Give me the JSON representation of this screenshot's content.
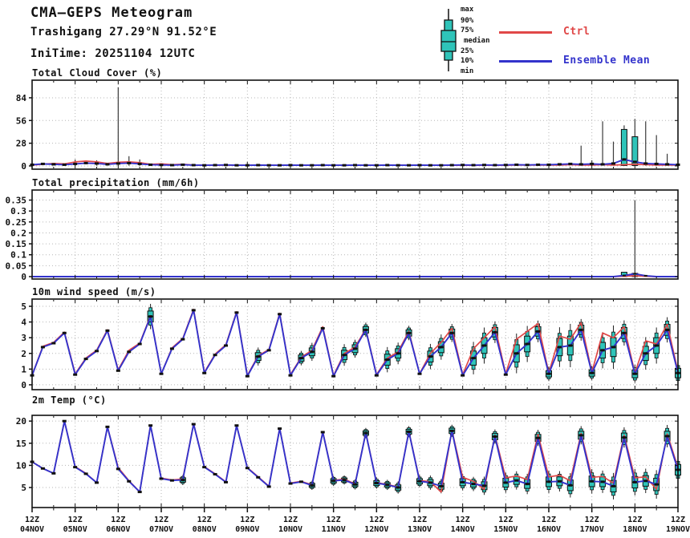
{
  "header": {
    "title": "CMA—GEPS Meteogram",
    "location": "Trashigang 27.29°N 91.52°E",
    "initime": "IniTime: 20251104 12UTC"
  },
  "legend": {
    "box_labels": [
      "max",
      "90%",
      "75%",
      "median",
      "25%",
      "10%",
      "min"
    ],
    "ctrl_label": "Ctrl",
    "mean_label": "Ensemble Mean",
    "ctrl_color": "#e04848",
    "mean_color": "#3333cc",
    "box_fill": "#2fc4b9"
  },
  "axis": {
    "z_label": "12Z",
    "day_labels": [
      "04NOV",
      "05NOV",
      "06NOV",
      "07NOV",
      "08NOV",
      "09NOV",
      "10NOV",
      "11NOV",
      "12NOV",
      "13NOV",
      "14NOV",
      "15NOV",
      "16NOV",
      "17NOV",
      "18NOV",
      "19NOV"
    ]
  },
  "chart_data": [
    {
      "type": "line",
      "title": "Total Cloud Cover (%)",
      "x_start": "04NOV 12Z",
      "x_step_hours": 6,
      "yticks": [
        0,
        28,
        56,
        84
      ],
      "ylim": [
        -4,
        105.7
      ],
      "markers": "all",
      "series": [
        {
          "name": "Ctrl",
          "color": "#e04848",
          "values": [
            1.0,
            2.0,
            3.0,
            2.5,
            5.0,
            6.0,
            5.0,
            3.0,
            4.5,
            5.0,
            4.0,
            2.0,
            2.5,
            1.5,
            2.0,
            1.0,
            1.0,
            0.8,
            1.0,
            0.8,
            0.8,
            0.8,
            0.8,
            0.8,
            0.8,
            0.8,
            0.8,
            0.8,
            0.8,
            0.8,
            0.8,
            0.8,
            0.8,
            0.8,
            0.8,
            0.8,
            0.8,
            0.8,
            0.8,
            0.8,
            0.8,
            0.8,
            0.8,
            0.8,
            0.8,
            1.0,
            1.0,
            1.0,
            1.0,
            1.0,
            1.5,
            1.0,
            1.0,
            1.5,
            1.0,
            1.5,
            2.0,
            1.5,
            1.0,
            1.0,
            1.0
          ]
        },
        {
          "name": "Ensemble Mean",
          "color": "#3333cc",
          "values": [
            1.5,
            2.5,
            2.0,
            1.5,
            2.5,
            3.5,
            3.0,
            2.0,
            3.0,
            3.5,
            2.5,
            1.5,
            1.2,
            1.0,
            1.5,
            1.0,
            0.8,
            1.0,
            1.2,
            0.8,
            0.8,
            1.0,
            0.8,
            0.8,
            1.0,
            0.8,
            0.8,
            1.0,
            0.8,
            0.8,
            1.0,
            0.8,
            0.8,
            1.0,
            0.8,
            0.8,
            1.0,
            0.8,
            0.8,
            1.0,
            1.2,
            1.0,
            1.2,
            1.0,
            1.2,
            1.5,
            1.2,
            1.5,
            1.5,
            2.0,
            2.5,
            2.0,
            2.5,
            2.0,
            3.0,
            8.0,
            5.0,
            3.0,
            2.5,
            2.0,
            1.5
          ]
        }
      ],
      "whiskers": [
        {
          "i": 4,
          "lo": 0.3,
          "hi": 8
        },
        {
          "i": 6,
          "lo": 0.3,
          "hi": 7
        },
        {
          "i": 8,
          "lo": 0.3,
          "hi": 97
        },
        {
          "i": 9,
          "lo": 0.3,
          "hi": 12
        },
        {
          "i": 10,
          "lo": 0.3,
          "hi": 8
        },
        {
          "i": 20,
          "lo": 0.3,
          "hi": 5
        },
        {
          "i": 51,
          "lo": 0.3,
          "hi": 25
        },
        {
          "i": 52,
          "lo": 0.3,
          "hi": 7
        },
        {
          "i": 53,
          "lo": 0.3,
          "hi": 55
        },
        {
          "i": 54,
          "lo": 0.3,
          "hi": 30
        },
        {
          "i": 55,
          "lo": 0.3,
          "hi": 50
        },
        {
          "i": 56,
          "lo": 0.3,
          "hi": 58
        },
        {
          "i": 57,
          "lo": 0.3,
          "hi": 55
        },
        {
          "i": 58,
          "lo": 0.3,
          "hi": 38
        },
        {
          "i": 59,
          "lo": 0.3,
          "hi": 15
        }
      ],
      "boxes": [
        {
          "i": 55,
          "q1": 0.5,
          "q3": 45
        },
        {
          "i": 56,
          "q1": 0.5,
          "q3": 36
        }
      ]
    },
    {
      "type": "line",
      "title": "Total precipitation (mm/6h)",
      "x_start": "04NOV 12Z",
      "x_step_hours": 6,
      "yticks": [
        0,
        0.05,
        0.1,
        0.15,
        0.2,
        0.25,
        0.3,
        0.35
      ],
      "ylim": [
        -0.011,
        0.396
      ],
      "markers": "sparse",
      "series": [
        {
          "name": "Ctrl",
          "color": "#e04848",
          "values": [
            0,
            0,
            0,
            0,
            0,
            0,
            0,
            0,
            0,
            0,
            0,
            0,
            0,
            0,
            0,
            0,
            0,
            0,
            0,
            0,
            0,
            0,
            0,
            0,
            0,
            0,
            0,
            0,
            0,
            0,
            0,
            0,
            0,
            0,
            0,
            0,
            0,
            0,
            0,
            0,
            0,
            0,
            0,
            0,
            0,
            0,
            0,
            0,
            0,
            0,
            0,
            0,
            0,
            0,
            0,
            0.002,
            0.004,
            0.001,
            0,
            0,
            0
          ]
        },
        {
          "name": "Ensemble Mean",
          "color": "#3333cc",
          "values": [
            0,
            0,
            0,
            0,
            0,
            0,
            0,
            0,
            0,
            0,
            0,
            0,
            0,
            0,
            0,
            0,
            0,
            0,
            0,
            0,
            0,
            0,
            0,
            0,
            0,
            0,
            0,
            0,
            0,
            0,
            0,
            0,
            0,
            0,
            0,
            0,
            0,
            0,
            0,
            0,
            0,
            0,
            0,
            0,
            0,
            0,
            0,
            0,
            0,
            0,
            0,
            0,
            0,
            0,
            0,
            0.005,
            0.013,
            0.004,
            0,
            0,
            0
          ]
        }
      ],
      "whiskers": [
        {
          "i": 56,
          "lo": 0,
          "hi": 0.35
        }
      ],
      "boxes": [
        {
          "i": 55,
          "q1": 0,
          "q3": 0.02
        },
        {
          "i": 56,
          "q1": 0,
          "q3": 0.015
        }
      ]
    },
    {
      "type": "line",
      "title": "10m wind speed (m/s)",
      "x_start": "04NOV 12Z",
      "x_step_hours": 6,
      "yticks": [
        0,
        1,
        2,
        3,
        4,
        5
      ],
      "ylim": [
        -0.31,
        5.46
      ],
      "markers": "all",
      "box_threshold": 0.2,
      "series": [
        {
          "name": "Ctrl",
          "color": "#e04848",
          "values": [
            0.6,
            2.45,
            2.7,
            3.35,
            0.7,
            1.7,
            2.2,
            3.5,
            0.95,
            2.2,
            2.65,
            4.4,
            0.7,
            2.35,
            2.95,
            4.8,
            0.8,
            1.95,
            2.55,
            4.65,
            0.6,
            1.85,
            2.25,
            4.55,
            0.65,
            1.75,
            2.2,
            3.7,
            0.6,
            2.0,
            2.4,
            3.55,
            0.65,
            1.7,
            2.1,
            3.4,
            0.7,
            2.0,
            2.7,
            3.6,
            0.65,
            2.3,
            3.0,
            3.7,
            0.7,
            2.9,
            3.4,
            3.9,
            0.75,
            3.1,
            2.9,
            3.95,
            0.8,
            3.3,
            3.0,
            3.7,
            0.75,
            2.8,
            2.6,
            3.85,
            0.85
          ]
        },
        {
          "name": "Ensemble Mean",
          "color": "#3333cc",
          "values": [
            0.6,
            2.4,
            2.65,
            3.3,
            0.65,
            1.65,
            2.15,
            3.45,
            0.9,
            2.1,
            2.6,
            4.35,
            0.7,
            2.3,
            2.9,
            4.75,
            0.75,
            1.9,
            2.5,
            4.6,
            0.55,
            1.8,
            2.2,
            4.5,
            0.6,
            1.7,
            2.1,
            3.6,
            0.55,
            1.9,
            2.3,
            3.5,
            0.6,
            1.6,
            2.0,
            3.3,
            0.7,
            1.8,
            2.4,
            3.3,
            0.6,
            1.7,
            2.5,
            3.35,
            0.65,
            2.0,
            2.6,
            3.4,
            0.7,
            2.4,
            2.5,
            3.5,
            0.75,
            2.2,
            2.4,
            3.3,
            0.7,
            2.0,
            2.5,
            3.5,
            0.75
          ]
        }
      ],
      "spread": [
        0.05,
        0.05,
        0.05,
        0.1,
        0.06,
        0.12,
        0.1,
        0.12,
        0.1,
        0.1,
        0.08,
        0.35,
        0.07,
        0.15,
        0.12,
        0.1,
        0.1,
        0.15,
        0.12,
        0.12,
        0.08,
        0.25,
        0.15,
        0.15,
        0.1,
        0.2,
        0.25,
        0.15,
        0.1,
        0.3,
        0.25,
        0.2,
        0.12,
        0.35,
        0.3,
        0.2,
        0.12,
        0.35,
        0.35,
        0.25,
        0.15,
        0.45,
        0.5,
        0.3,
        0.15,
        0.55,
        0.5,
        0.3,
        0.2,
        0.55,
        0.6,
        0.3,
        0.2,
        0.5,
        0.6,
        0.35,
        0.25,
        0.45,
        0.5,
        0.35,
        0.3
      ]
    },
    {
      "type": "line",
      "title": "2m Temp (°C)",
      "x_start": "04NOV 12Z",
      "x_step_hours": 6,
      "yticks": [
        5,
        10,
        15,
        20
      ],
      "ylim": [
        0.48,
        21.3
      ],
      "markers": "all",
      "box_threshold": 0.45,
      "series": [
        {
          "name": "Ctrl",
          "color": "#e04848",
          "values": [
            10.8,
            9.3,
            8.2,
            20.0,
            9.7,
            8.2,
            6.1,
            18.7,
            9.5,
            6.5,
            4.0,
            19.0,
            7.1,
            6.7,
            6.9,
            19.4,
            9.7,
            8.1,
            6.3,
            19.0,
            9.5,
            7.4,
            5.3,
            18.4,
            6.0,
            6.4,
            5.6,
            17.6,
            6.6,
            6.9,
            5.8,
            17.4,
            6.1,
            5.7,
            5.1,
            17.7,
            6.6,
            6.3,
            4.0,
            17.9,
            7.3,
            6.4,
            4.6,
            16.8,
            7.2,
            7.6,
            6.8,
            17.0,
            7.4,
            7.8,
            6.5,
            17.2,
            7.3,
            7.5,
            6.0,
            16.8,
            7.2,
            7.4,
            4.6,
            17.1,
            9.5
          ]
        },
        {
          "name": "Ensemble Mean",
          "color": "#3333cc",
          "values": [
            10.8,
            9.3,
            8.2,
            20.0,
            9.6,
            8.1,
            6.1,
            18.7,
            9.2,
            6.4,
            4.0,
            19.0,
            7.0,
            6.6,
            6.7,
            19.3,
            9.6,
            8.0,
            6.2,
            19.0,
            9.4,
            7.3,
            5.2,
            18.3,
            5.9,
            6.3,
            5.5,
            17.5,
            6.5,
            6.7,
            5.7,
            17.3,
            6.0,
            5.6,
            5.0,
            17.6,
            6.4,
            6.1,
            5.3,
            17.8,
            6.2,
            5.8,
            5.4,
            16.5,
            6.1,
            6.6,
            5.8,
            16.2,
            6.3,
            6.4,
            5.5,
            16.8,
            6.4,
            6.3,
            5.3,
            16.3,
            6.2,
            6.5,
            5.7,
            16.6,
            9.0
          ]
        }
      ],
      "spread": [
        0.15,
        0.2,
        0.25,
        0.2,
        0.2,
        0.25,
        0.3,
        0.25,
        0.3,
        0.3,
        0.35,
        0.3,
        0.25,
        0.3,
        0.5,
        0.35,
        0.3,
        0.3,
        0.4,
        0.3,
        0.35,
        0.3,
        0.4,
        0.35,
        0.4,
        0.35,
        0.45,
        0.4,
        0.5,
        0.45,
        0.5,
        0.5,
        0.55,
        0.5,
        0.6,
        0.55,
        0.6,
        0.7,
        0.7,
        0.6,
        0.8,
        0.7,
        0.9,
        0.7,
        1.0,
        0.9,
        1.0,
        0.8,
        1.1,
        1.0,
        1.2,
        0.9,
        1.2,
        1.1,
        1.3,
        1.0,
        1.3,
        1.2,
        1.4,
        1.1,
        1.2
      ]
    }
  ]
}
